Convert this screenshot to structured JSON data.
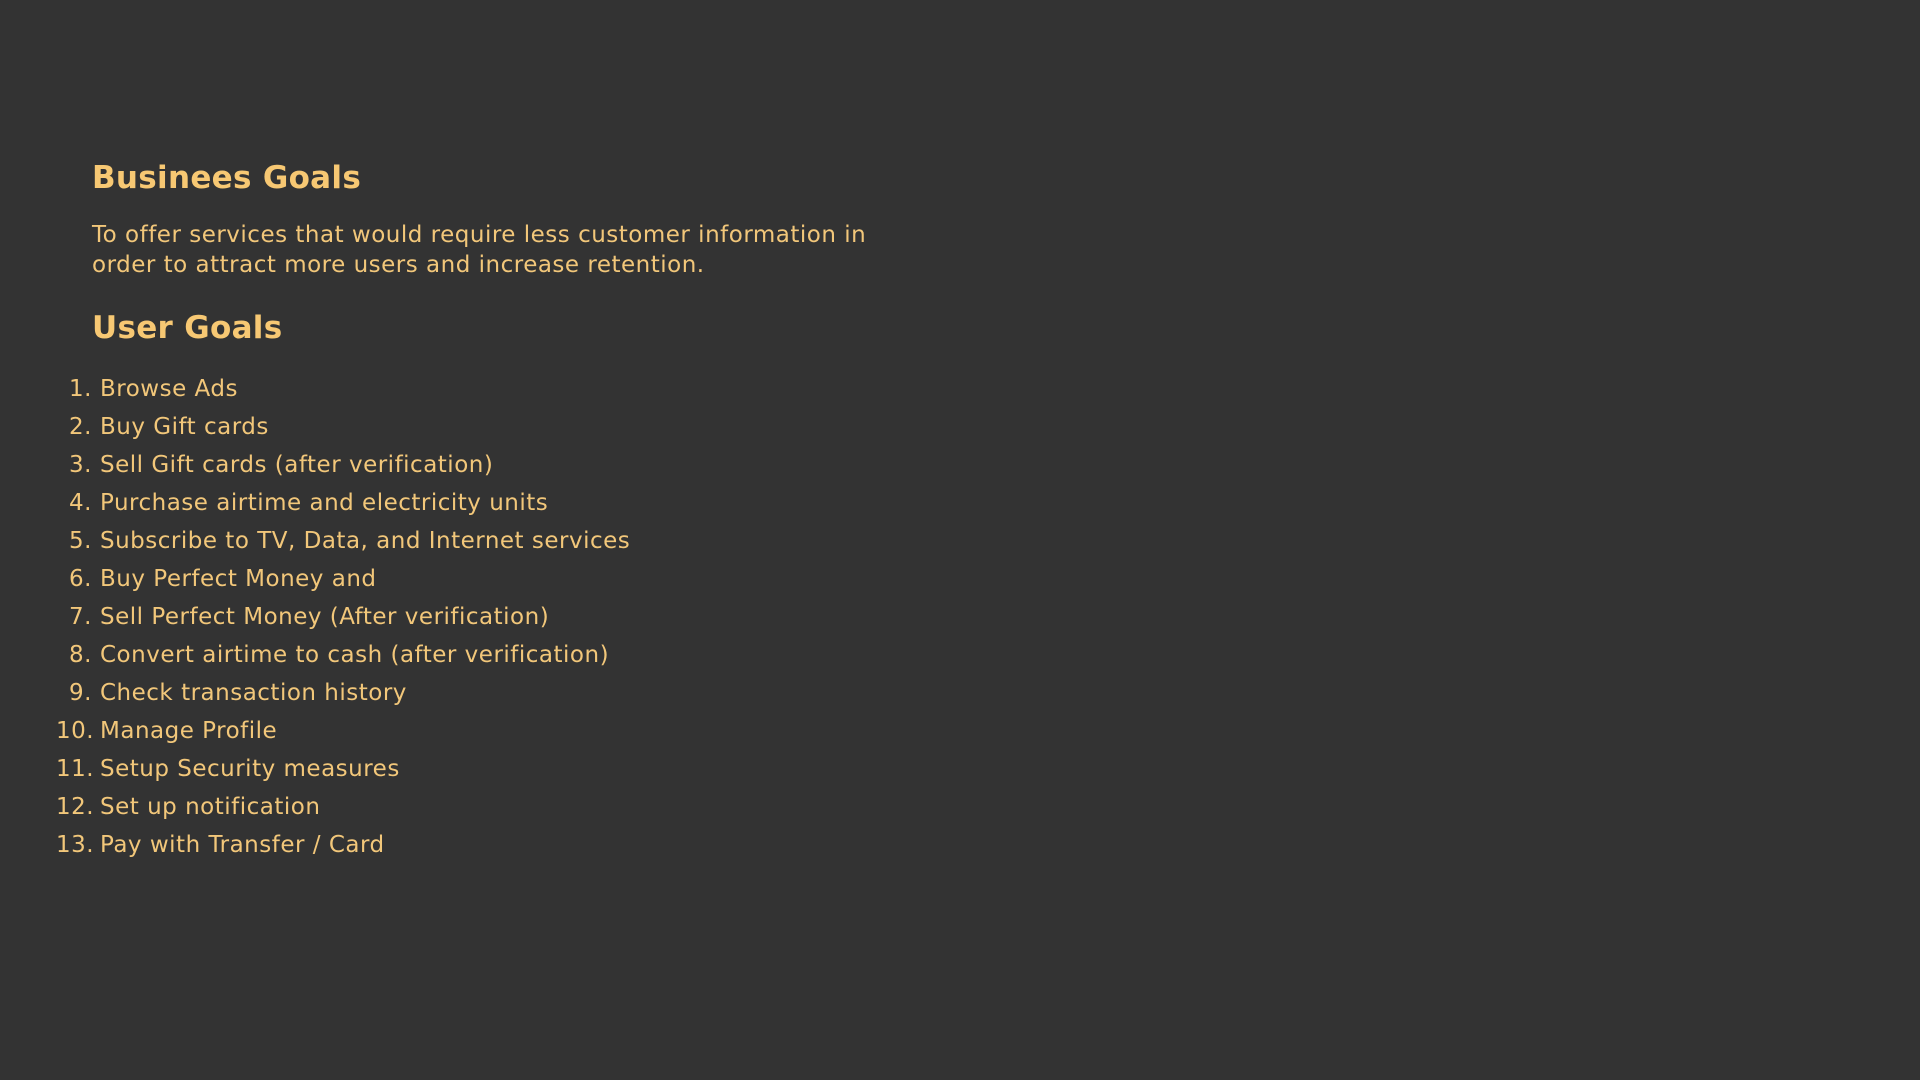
{
  "colors": {
    "background": "#333333",
    "text": "#f2c77a",
    "heading": "#f7c873"
  },
  "business": {
    "title": "Businees Goals",
    "description_line1": "To offer services that would require less customer information in",
    "description_line2": "order to attract more users and increase retention."
  },
  "user": {
    "title": "User Goals",
    "goals": [
      {
        "num": "1.",
        "text": "Browse Ads"
      },
      {
        "num": "2.",
        "text": "Buy Gift cards"
      },
      {
        "num": "3.",
        "text": "Sell Gift cards (after verification)"
      },
      {
        "num": "4.",
        "text": "Purchase airtime and electricity units"
      },
      {
        "num": "5.",
        "text": "Subscribe to TV, Data, and Internet services"
      },
      {
        "num": "6.",
        "text": "Buy Perfect Money and"
      },
      {
        "num": "7.",
        "text": "Sell Perfect Money (After verification)"
      },
      {
        "num": "8.",
        "text": "Convert airtime to cash (after verification)"
      },
      {
        "num": "9.",
        "text": "Check transaction history"
      },
      {
        "num": "10.",
        "text": "Manage Profile"
      },
      {
        "num": "11.",
        "text": "Setup Security measures"
      },
      {
        "num": "12.",
        "text": "Set up notification"
      },
      {
        "num": "13.",
        "text": "Pay with Transfer / Card"
      }
    ]
  }
}
